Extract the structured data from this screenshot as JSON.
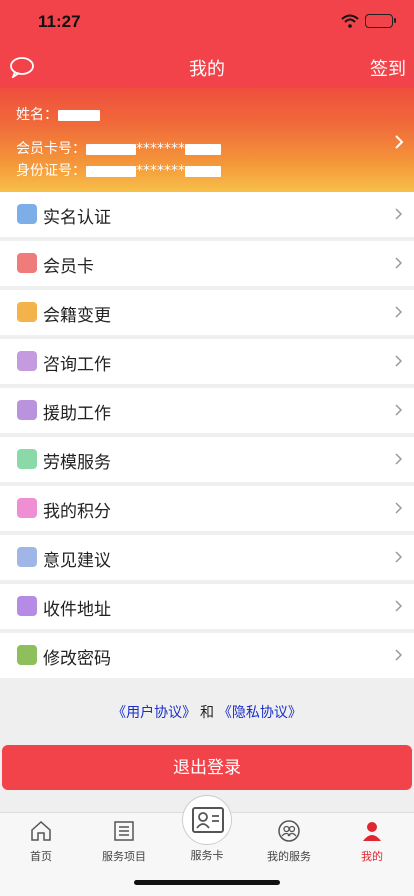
{
  "status": {
    "time": "11:27"
  },
  "nav": {
    "title": "我的",
    "checkin": "签到"
  },
  "profile": {
    "name_label": "姓名：",
    "card_label": "会员卡号：",
    "card_masked": "*******",
    "id_label": "身份证号：",
    "id_masked": "*******"
  },
  "menu": [
    {
      "label": "实名认证",
      "icon": "person-icon",
      "color": "#7eaee8"
    },
    {
      "label": "会员卡",
      "icon": "card-icon",
      "color": "#f07b7b"
    },
    {
      "label": "会籍变更",
      "icon": "change-icon",
      "color": "#f4b24a"
    },
    {
      "label": "咨询工作",
      "icon": "graduation-cap-icon",
      "color": "#c59be0"
    },
    {
      "label": "援助工作",
      "icon": "graduation-cap-icon",
      "color": "#b993dd"
    },
    {
      "label": "劳模服务",
      "icon": "trophy-icon",
      "color": "#8bd9a8"
    },
    {
      "label": "我的积分",
      "icon": "cart-icon",
      "color": "#ef8ed2"
    },
    {
      "label": "意见建议",
      "icon": "edit-icon",
      "color": "#9fb6e6"
    },
    {
      "label": "收件地址",
      "icon": "location-icon",
      "color": "#b58be5"
    },
    {
      "label": "修改密码",
      "icon": "key-icon",
      "color": "#8fbe5c"
    }
  ],
  "agreement": {
    "user": "《用户协议》",
    "and": " 和 ",
    "privacy": "《隐私协议》"
  },
  "logout": "退出登录",
  "tabs": [
    {
      "label": "首页",
      "icon": "home-icon"
    },
    {
      "label": "服务项目",
      "icon": "list-icon"
    },
    {
      "label": "服务卡",
      "icon": "id-card-icon"
    },
    {
      "label": "我的服务",
      "icon": "people-icon"
    },
    {
      "label": "我的",
      "icon": "user-icon",
      "active": true
    }
  ],
  "colors": {
    "accent": "#f2424a",
    "link": "#1a2fc8",
    "active_tab": "#e0262e"
  }
}
